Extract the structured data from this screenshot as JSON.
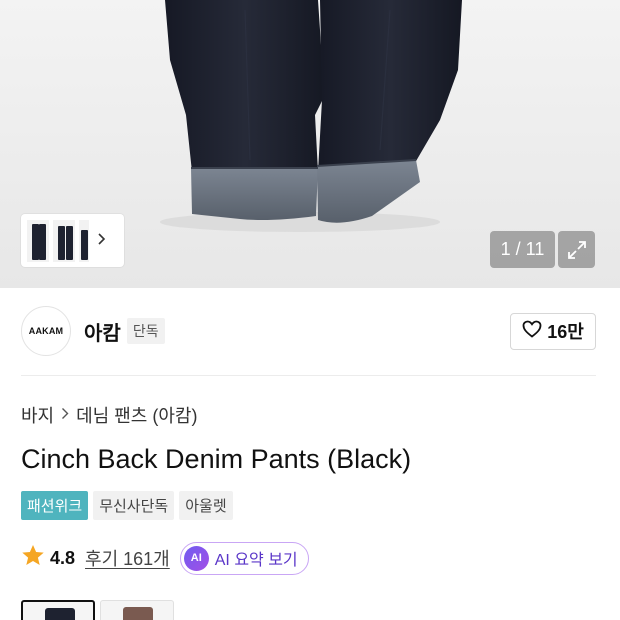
{
  "gallery": {
    "counter": "1 / 11",
    "thumbnail_arrow": "chevron-right-icon",
    "expand_icon": "expand-icon"
  },
  "brand": {
    "logo_text": "AAKAM",
    "name": "아캄",
    "tag": "단독",
    "like_icon": "heart-outline-icon",
    "like_count": "16만"
  },
  "breadcrumb": {
    "category": "바지",
    "separator_icon": "chevron-right-icon",
    "subcategory": "데님 팬츠 (아캄)"
  },
  "product": {
    "title": "Cinch Back Denim Pants (Black)",
    "tags": [
      "패션위크",
      "무신사단독",
      "아울렛"
    ],
    "rating": "4.8",
    "rating_icon": "star-icon",
    "reviews": "후기 161개",
    "ai_badge": "AI",
    "ai_label": "AI 요약 보기"
  },
  "colors": {
    "accent_tag": "#4fb4be",
    "star": "#f5a623",
    "ai_gradient_start": "#6f5cf0",
    "ai_gradient_end": "#a34fe6",
    "denim": "#1e2230",
    "cuff": "#6b7582"
  }
}
